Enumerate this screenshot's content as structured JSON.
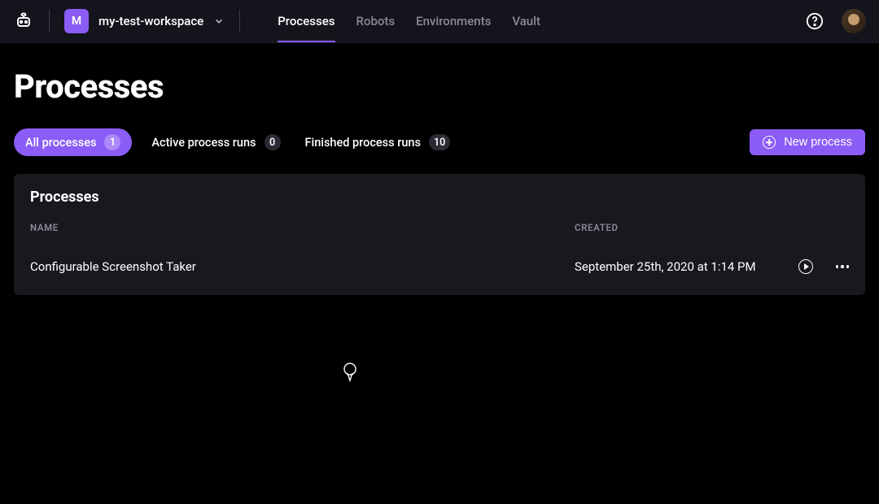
{
  "header": {
    "workspace_initial": "M",
    "workspace_name": "my-test-workspace",
    "nav": {
      "processes": "Processes",
      "robots": "Robots",
      "environments": "Environments",
      "vault": "Vault"
    }
  },
  "page": {
    "title": "Processes"
  },
  "filters": {
    "all": {
      "label": "All processes",
      "count": "1"
    },
    "active": {
      "label": "Active process runs",
      "count": "0"
    },
    "finished": {
      "label": "Finished process runs",
      "count": "10"
    }
  },
  "new_button_label": "New process",
  "panel": {
    "title": "Processes",
    "columns": {
      "name": "NAME",
      "created": "CREATED"
    },
    "rows": [
      {
        "name": "Configurable Screenshot Taker",
        "created": "September 25th, 2020 at 1:14 PM"
      }
    ]
  }
}
